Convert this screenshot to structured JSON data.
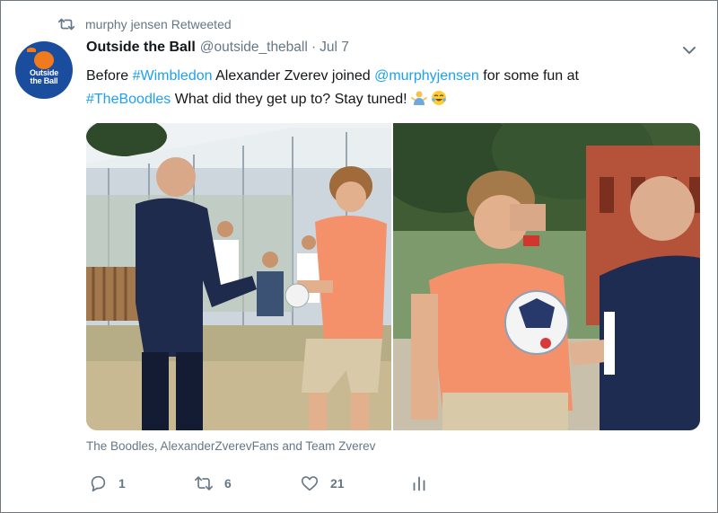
{
  "retweet": {
    "label": "murphy jensen Retweeted",
    "icon": "retweet-icon"
  },
  "account": {
    "display_name": "Outside the Ball",
    "handle": "@outside_theball",
    "separator": "·",
    "date": "Jul 7",
    "avatar_logo_line1": "Outside",
    "avatar_logo_line2": "the Ball"
  },
  "tweet": {
    "text_1": "Before ",
    "hashtag_1": "#Wimbledon",
    "text_2": " Alexander Zverev joined ",
    "mention": "@murphyjensen",
    "text_3": " for some fun at",
    "hashtag_2": "#TheBoodles",
    "text_4": " What did they get up to? Stay tuned! ",
    "emoji_1": "person-shrugging-emoji",
    "emoji_2": "tears-of-joy-emoji"
  },
  "tagged_people": "The Boodles, AlexanderZverevFans and Team Zverev",
  "actions": {
    "reply_count": "1",
    "retweet_count": "6",
    "like_count": "21",
    "analytics_icon": "bar-chart-icon"
  },
  "colors": {
    "link": "#1da1f2",
    "secondary_text": "#657786",
    "avatar_bg": "#1b4d9e",
    "logo_accent": "#f07a1e",
    "shirt_salmon": "#f4916a"
  }
}
